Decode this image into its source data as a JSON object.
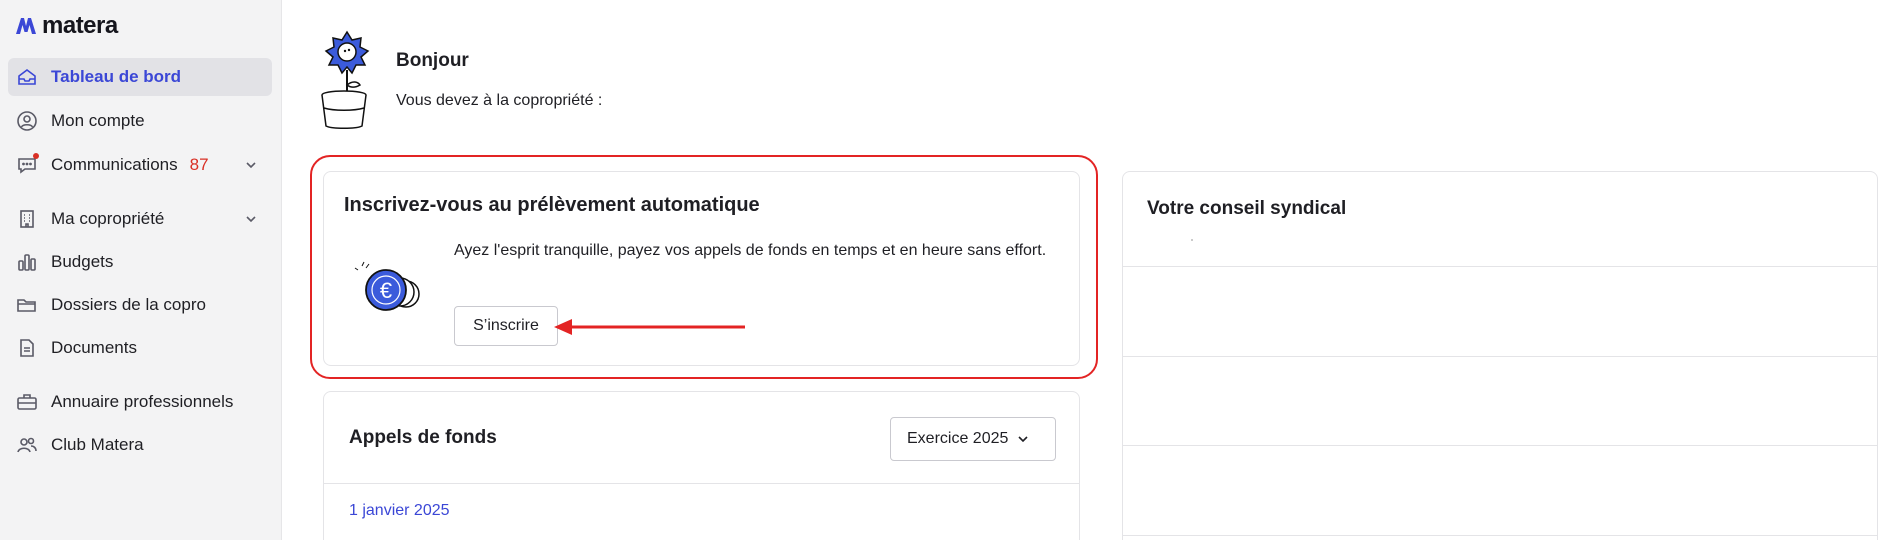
{
  "app": {
    "logo_text": "matera"
  },
  "sidebar": {
    "items": [
      {
        "label": "Tableau de bord",
        "icon": "home-icon",
        "active": true
      },
      {
        "label": "Mon compte",
        "icon": "user-circle-icon"
      },
      {
        "label": "Communications",
        "icon": "chat-icon",
        "badge": "87",
        "expandable": true
      },
      {
        "label": "Ma copropriété",
        "icon": "building-icon",
        "expandable": true
      },
      {
        "label": "Budgets",
        "icon": "bar-chart-icon"
      },
      {
        "label": "Dossiers de la copro",
        "icon": "folder-icon"
      },
      {
        "label": "Documents",
        "icon": "document-icon"
      },
      {
        "label": "Annuaire professionnels",
        "icon": "briefcase-icon"
      },
      {
        "label": "Club Matera",
        "icon": "users-icon"
      }
    ]
  },
  "greeting": {
    "title": "Bonjour",
    "subtitle": "Vous devez à la copropriété :"
  },
  "direct_debit": {
    "title": "Inscrivez-vous au prélèvement automatique",
    "text": "Ayez l'esprit tranquille, payez vos appels de fonds en temps et en heure sans effort.",
    "button_label": "S’inscrire",
    "coin_symbol": "€"
  },
  "funds": {
    "title": "Appels de fonds",
    "select_value": "Exercice 2025",
    "first_date": "1 janvier 2025"
  },
  "council": {
    "title": "Votre conseil syndical"
  },
  "colors": {
    "accent": "#3b47d6",
    "highlight": "#e32424",
    "badge": "#d93025"
  }
}
